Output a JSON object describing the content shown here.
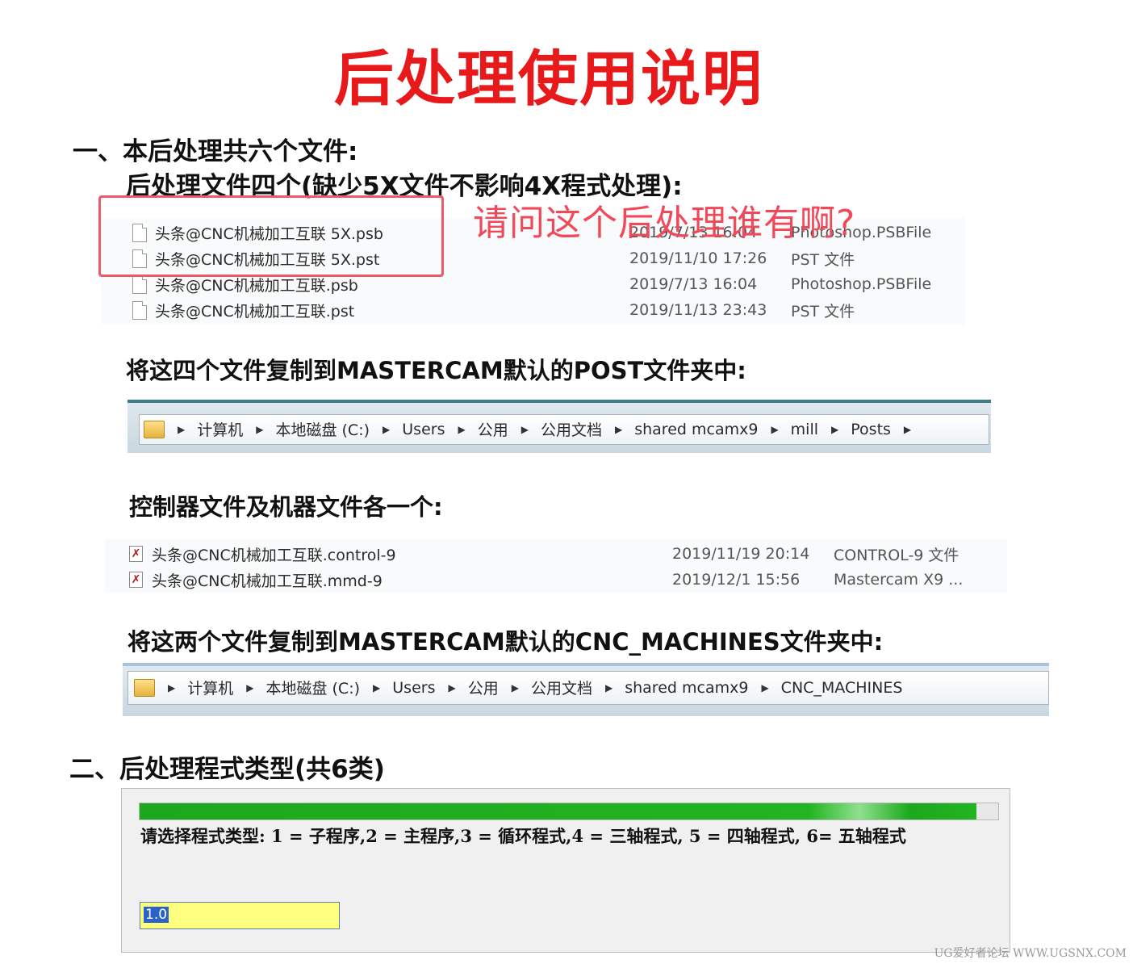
{
  "title": "后处理使用说明",
  "section1": {
    "heading": "一、本后处理共六个文件:",
    "post_heading": "后处理文件四个(缺少5X文件不影响4X程式处理):",
    "question": "请问这个后处理谁有啊?",
    "post_files": [
      {
        "name": "头条@CNC机械加工互联 5X.psb",
        "date": "2019/7/13 16:04",
        "type": "Photoshop.PSBFile"
      },
      {
        "name": "头条@CNC机械加工互联 5X.pst",
        "date": "2019/11/10 17:26",
        "type": "PST 文件"
      },
      {
        "name": "头条@CNC机械加工互联.psb",
        "date": "2019/7/13 16:04",
        "type": "Photoshop.PSBFile"
      },
      {
        "name": "头条@CNC机械加工互联.pst",
        "date": "2019/11/13 23:43",
        "type": "PST 文件"
      }
    ],
    "copy_post": "将这四个文件复制到MASTERCAM默认的POST文件夹中:",
    "post_path": [
      "计算机",
      "本地磁盘 (C:)",
      "Users",
      "公用",
      "公用文档",
      "shared mcamx9",
      "mill",
      "Posts"
    ],
    "control_heading": "控制器文件及机器文件各一个:",
    "control_files": [
      {
        "name": "头条@CNC机械加工互联.control-9",
        "date": "2019/11/19 20:14",
        "type": "CONTROL-9 文件"
      },
      {
        "name": "头条@CNC机械加工互联.mmd-9",
        "date": "2019/12/1 15:56",
        "type": "Mastercam X9 ..."
      }
    ],
    "copy_machine": "将这两个文件复制到MASTERCAM默认的CNC_MACHINES文件夹中:",
    "machine_path": [
      "计算机",
      "本地磁盘 (C:)",
      "Users",
      "公用",
      "公用文档",
      "shared mcamx9",
      "CNC_MACHINES"
    ]
  },
  "section2": {
    "heading": "二、后处理程式类型(共6类)",
    "prompt": "请选择程式类型: 1 = 子程序,2 = 主程序,3 = 循环程式,4 = 三轴程式, 5 = 四轴程式, 6= 五轴程式",
    "input_value": "1.0",
    "progress": 0.975
  },
  "watermark": "UG爱好者论坛 WWW.UGSNX.COM"
}
